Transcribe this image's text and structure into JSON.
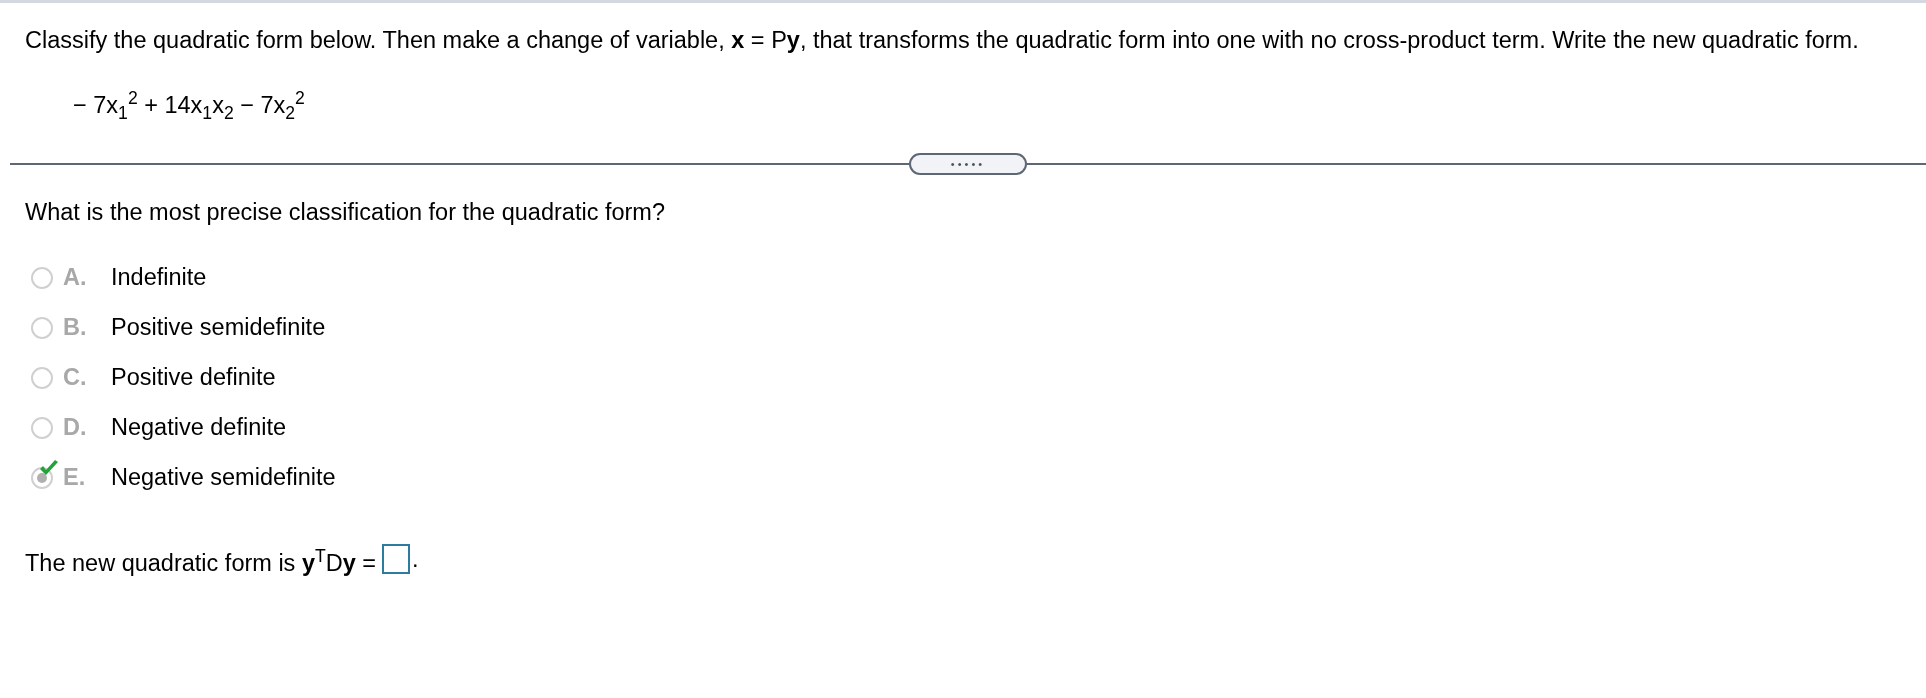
{
  "instructions": "Classify the quadratic form below. Then make a change of variable, **x** = P**y**, that transforms the quadratic form into one with no cross-product term. Write the new quadratic form.",
  "formula": "− 7x$_{1}$$^{2}$ + 14x$_{1}$x$_{2}$ − 7x$_{2}$$^{2}$",
  "expand_button": "•••••",
  "question": "What is the most precise classification for the quadratic form?",
  "options": [
    {
      "letter": "A.",
      "label": "Indefinite",
      "selected": false,
      "marked_correct": false
    },
    {
      "letter": "B.",
      "label": "Positive semidefinite",
      "selected": false,
      "marked_correct": false
    },
    {
      "letter": "C.",
      "label": "Positive definite",
      "selected": false,
      "marked_correct": false
    },
    {
      "letter": "D.",
      "label": "Negative definite",
      "selected": false,
      "marked_correct": false
    },
    {
      "letter": "E.",
      "label": "Negative semidefinite",
      "selected": true,
      "marked_correct": true
    }
  ],
  "answer": {
    "prompt": "The new quadratic form is **y**$^{T}$D**y** =",
    "suffix": "."
  }
}
